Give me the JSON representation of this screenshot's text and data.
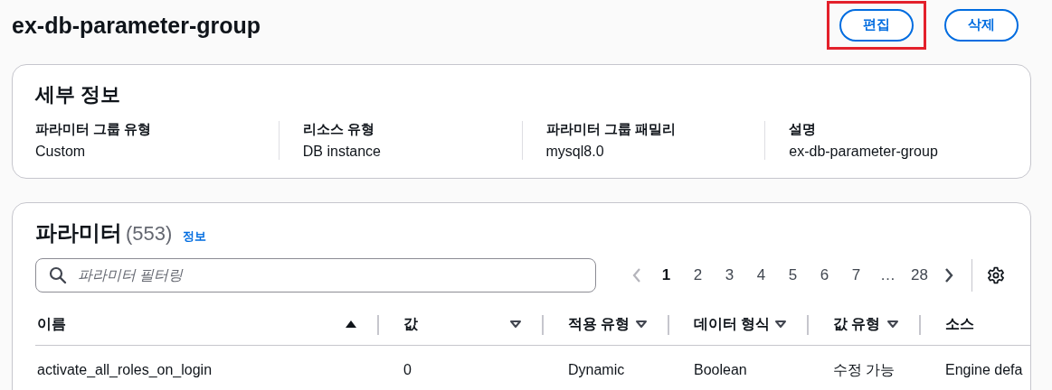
{
  "header": {
    "title": "ex-db-parameter-group",
    "buttons": [
      {
        "label": "편집",
        "highlighted": true
      },
      {
        "label": "삭제",
        "highlighted": false
      }
    ]
  },
  "details": {
    "title": "세부 정보",
    "fields": [
      {
        "label": "파라미터 그룹 유형",
        "value": "Custom"
      },
      {
        "label": "리소스 유형",
        "value": "DB instance"
      },
      {
        "label": "파라미터 그룹 패밀리",
        "value": "mysql8.0"
      },
      {
        "label": "설명",
        "value": "ex-db-parameter-group"
      }
    ]
  },
  "parameters": {
    "title": "파라미터",
    "count": "(553)",
    "info_link": "정보",
    "search": {
      "placeholder": "파라미터 필터링"
    },
    "pagination": {
      "previous_disabled": true,
      "next_disabled": false,
      "pages": [
        {
          "label": "1",
          "selected": true
        },
        {
          "label": "2",
          "selected": false
        },
        {
          "label": "3",
          "selected": false
        },
        {
          "label": "4",
          "selected": false
        },
        {
          "label": "5",
          "selected": false
        },
        {
          "label": "6",
          "selected": false
        },
        {
          "label": "7",
          "selected": false
        },
        {
          "label": "…",
          "selected": false
        },
        {
          "label": "28",
          "selected": false
        }
      ]
    },
    "table": {
      "columns": [
        {
          "label": "이름",
          "sortable": true,
          "sorted": true
        },
        {
          "label": "값",
          "sortable": true,
          "sorted": false
        },
        {
          "label": "적용 유형",
          "sortable": true,
          "sorted": false
        },
        {
          "label": "데이터 형식",
          "sortable": true,
          "sorted": false
        },
        {
          "label": "값 유형",
          "sortable": true,
          "sorted": false
        },
        {
          "label": "소스",
          "sortable": false
        }
      ],
      "rows": [
        [
          "activate_all_roles_on_login",
          "0",
          "Dynamic",
          "Boolean",
          "수정 가능",
          "Engine defa"
        ]
      ]
    }
  }
}
